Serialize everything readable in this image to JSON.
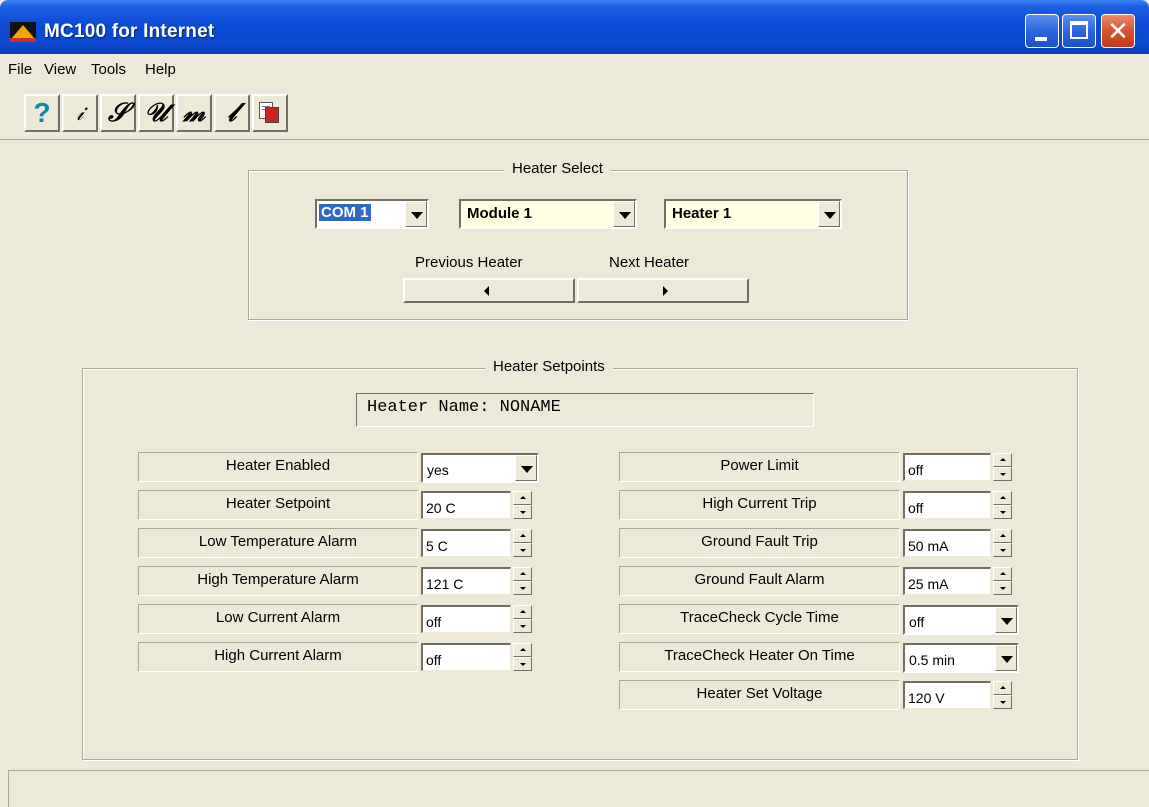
{
  "window": {
    "title": "MC100 for Internet"
  },
  "menu": [
    "File",
    "View",
    "Tools",
    "Help"
  ],
  "toolbar": {
    "buttons": [
      {
        "name": "help-icon",
        "glyph": "?"
      },
      {
        "name": "info-icon",
        "glyph": "ℹ"
      },
      {
        "name": "s-icon",
        "glyph": "S"
      },
      {
        "name": "u-icon",
        "glyph": "U"
      },
      {
        "name": "m-icon",
        "glyph": "M"
      },
      {
        "name": "l-icon",
        "glyph": "L"
      },
      {
        "name": "export-icon",
        "glyph": ""
      }
    ]
  },
  "heater_select": {
    "title": "Heater Select",
    "com": "COM 1",
    "module": "Module 1",
    "heater": "Heater 1",
    "prev_label": "Previous Heater",
    "next_label": "Next Heater"
  },
  "setpoints": {
    "title": "Heater Setpoints",
    "heater_name": "Heater Name:  NONAME",
    "left": [
      {
        "label": "Heater Enabled",
        "value": "yes",
        "control": "combo"
      },
      {
        "label": "Heater Setpoint",
        "value": "20 C",
        "control": "spin"
      },
      {
        "label": "Low Temperature Alarm",
        "value": "5 C",
        "control": "spin"
      },
      {
        "label": "High Temperature Alarm",
        "value": "121 C",
        "control": "spin"
      },
      {
        "label": "Low Current Alarm",
        "value": "off",
        "control": "spin"
      },
      {
        "label": "High Current Alarm",
        "value": "off",
        "control": "spin"
      }
    ],
    "right": [
      {
        "label": "Power Limit",
        "value": "off",
        "control": "spin"
      },
      {
        "label": "High Current Trip",
        "value": "off",
        "control": "spin"
      },
      {
        "label": "Ground Fault Trip",
        "value": "50 mA",
        "control": "spin"
      },
      {
        "label": "Ground Fault Alarm",
        "value": "25 mA",
        "control": "spin"
      },
      {
        "label": "TraceCheck Cycle Time",
        "value": "off",
        "control": "combo"
      },
      {
        "label": "TraceCheck Heater On Time",
        "value": "0.5 min",
        "control": "combo"
      },
      {
        "label": "Heater Set Voltage",
        "value": "120 V",
        "control": "spin"
      }
    ]
  }
}
